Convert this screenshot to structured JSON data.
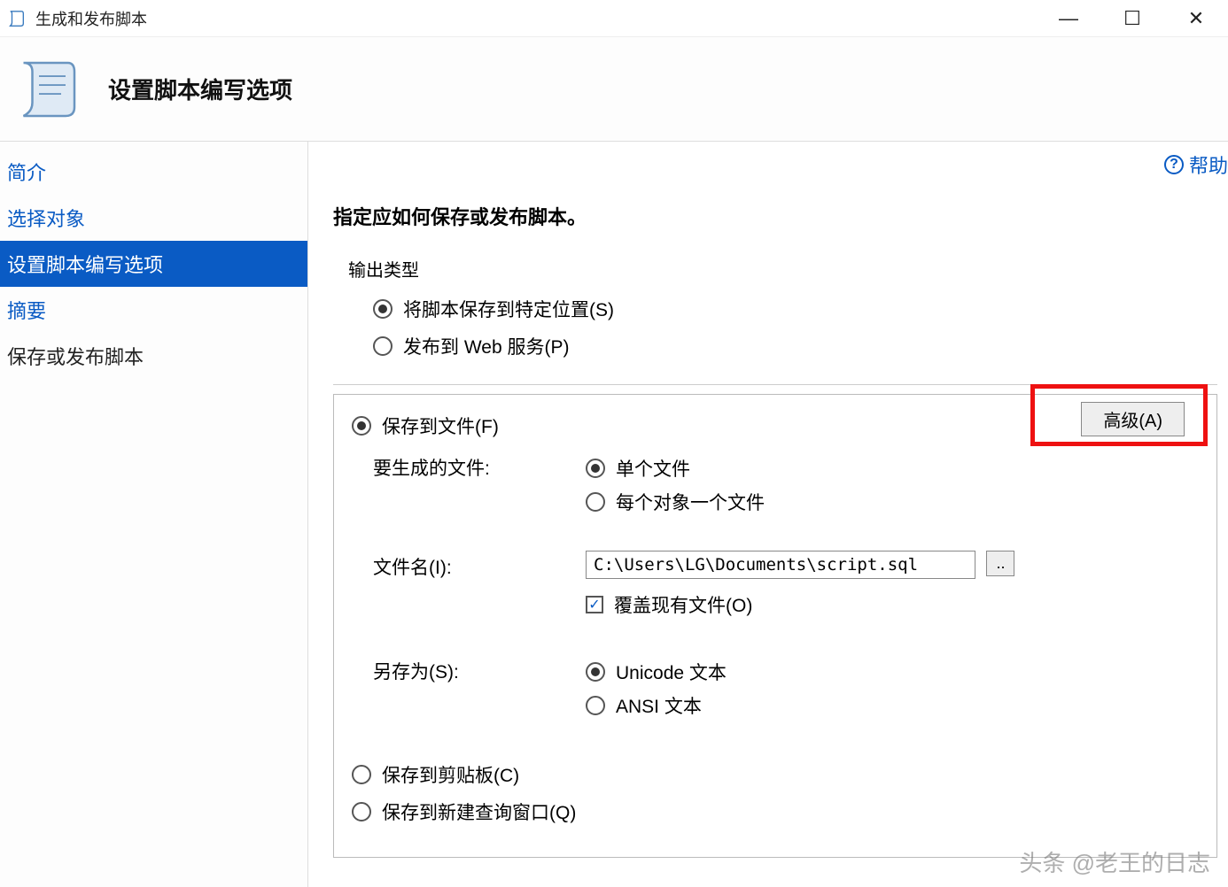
{
  "window": {
    "title": "生成和发布脚本"
  },
  "banner": {
    "title": "设置脚本编写选项"
  },
  "sidebar": {
    "items": [
      {
        "label": "简介"
      },
      {
        "label": "选择对象"
      },
      {
        "label": "设置脚本编写选项"
      },
      {
        "label": "摘要"
      },
      {
        "label": "保存或发布脚本"
      }
    ]
  },
  "help": {
    "label": "帮助"
  },
  "main": {
    "heading": "指定应如何保存或发布脚本。",
    "output_type": {
      "label": "输出类型",
      "save_location": "将脚本保存到特定位置(S)",
      "publish_web": "发布到 Web 服务(P)"
    },
    "save_to_file": {
      "label": "保存到文件(F)",
      "advanced_btn": "高级(A)",
      "files_to_generate": {
        "label": "要生成的文件:",
        "single": "单个文件",
        "per_object": "每个对象一个文件"
      },
      "filename": {
        "label": "文件名(I):",
        "value": "C:\\Users\\LG\\Documents\\script.sql",
        "browse": "..",
        "overwrite": "覆盖现有文件(O)"
      },
      "save_as": {
        "label": "另存为(S):",
        "unicode": "Unicode 文本",
        "ansi": "ANSI 文本"
      }
    },
    "save_clipboard": "保存到剪贴板(C)",
    "save_new_query": "保存到新建查询窗口(Q)"
  },
  "watermark": "头条 @老王的日志"
}
